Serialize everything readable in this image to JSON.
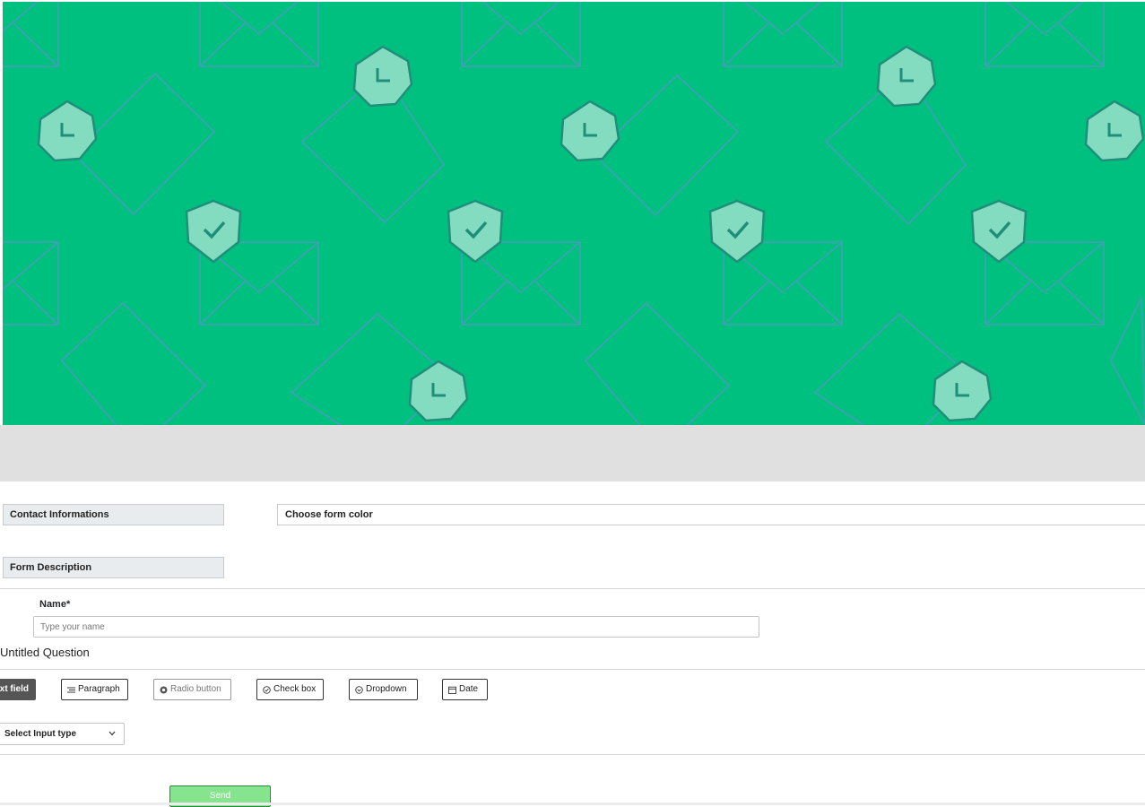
{
  "banner": {
    "background_color": "#00c07f",
    "pattern": "envelope-clock-shield-pattern"
  },
  "form": {
    "title_field": "Contact Informations",
    "color_picker_label": "Choose form color",
    "description_field": "Form Description"
  },
  "name_field": {
    "label": "Name*",
    "placeholder": "Type your name"
  },
  "question": {
    "title": "Untitled Question",
    "types": {
      "text_field": "ext field",
      "paragraph": "Paragraph",
      "radio": "Radio button",
      "checkbox": "Check box",
      "dropdown": "Dropdown",
      "date": "Date"
    },
    "select_input_type": "Select Input type"
  },
  "send_label": "Send",
  "colors": {
    "accent": "#00c07f",
    "send_bg": "#86e38e",
    "active_type": "#555555"
  }
}
